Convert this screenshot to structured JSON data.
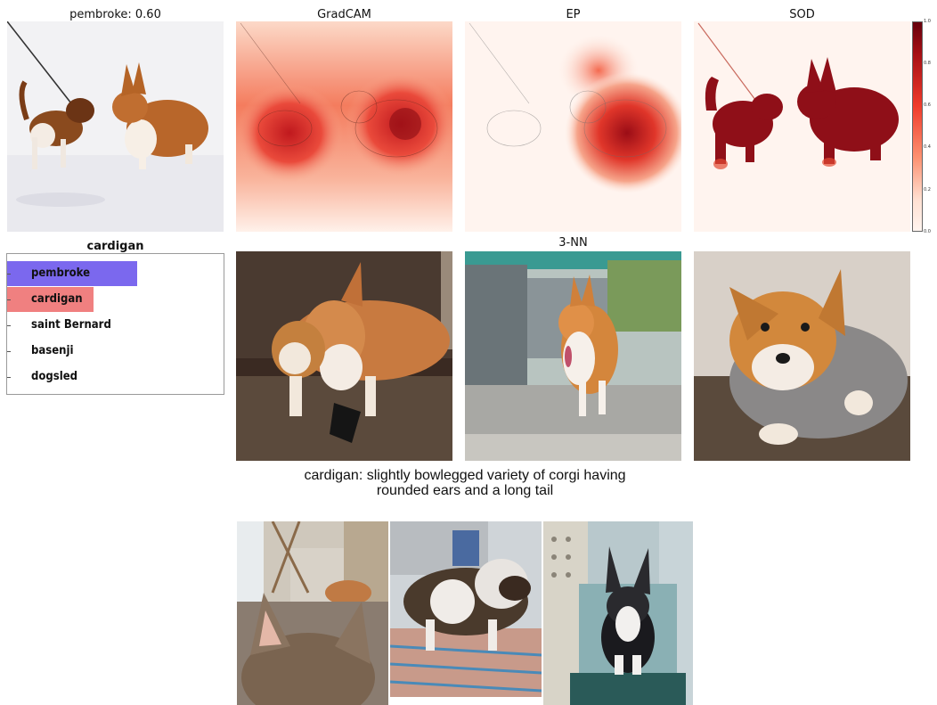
{
  "panels": {
    "original_title": "pembroke: 0.60",
    "gradcam_title": "GradCAM",
    "ep_title": "EP",
    "sod_title": "SOD"
  },
  "colorbar": {
    "ticks": [
      "1.0",
      "0.8",
      "0.6",
      "0.4",
      "0.2",
      "0.0"
    ],
    "colors": {
      "high": "#67000d",
      "mid": "#ef3b2c",
      "low": "#fff5f0"
    }
  },
  "predictions": {
    "title": "cardigan",
    "items": [
      {
        "label": "pembroke",
        "bar_fraction": 0.6,
        "color": "#7b68ee"
      },
      {
        "label": "cardigan",
        "bar_fraction": 0.4,
        "color": "#f08080"
      },
      {
        "label": "saint Bernard",
        "bar_fraction": 0,
        "color": "#ffffff"
      },
      {
        "label": "basenji",
        "bar_fraction": 0,
        "color": "#ffffff"
      },
      {
        "label": "dogsled",
        "bar_fraction": 0,
        "color": "#ffffff"
      }
    ]
  },
  "nn": {
    "title": "3-NN"
  },
  "definition": {
    "line1": "cardigan: slightly bowlegged variety of corgi having",
    "line2": "rounded ears and a long tail"
  }
}
